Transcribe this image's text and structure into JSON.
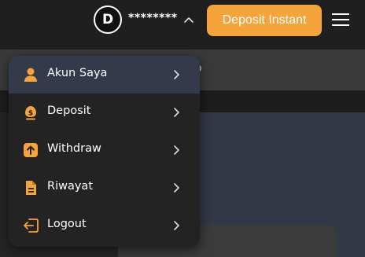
{
  "header": {
    "avatar_initial": "D",
    "masked_username": "********",
    "deposit_button_label": "Deposit Instant",
    "accent_color": "#f5a33b"
  },
  "background": {
    "partial_tab_text": "o"
  },
  "menu": {
    "items": [
      {
        "label": "Akun Saya",
        "icon": "user-icon",
        "active": true
      },
      {
        "label": "Deposit",
        "icon": "money-bag-icon",
        "active": false
      },
      {
        "label": "Withdraw",
        "icon": "arrow-up-box-icon",
        "active": false
      },
      {
        "label": "Riwayat",
        "icon": "document-icon",
        "active": false
      },
      {
        "label": "Logout",
        "icon": "logout-icon",
        "active": false
      }
    ]
  }
}
